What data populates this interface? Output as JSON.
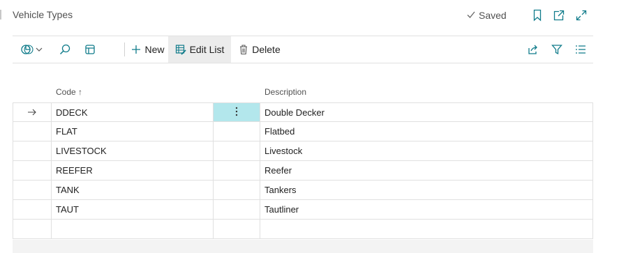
{
  "page": {
    "title": "Vehicle Types",
    "saved_label": "Saved"
  },
  "toolbar": {
    "new_label": "New",
    "edit_list_label": "Edit List",
    "delete_label": "Delete"
  },
  "colors": {
    "accent": "#0f7b8a",
    "selected_cell": "#b3e7ec",
    "active_button": "#ececec"
  },
  "table": {
    "columns": {
      "code": "Code",
      "sort_indicator": "↑",
      "description": "Description"
    },
    "rows": [
      {
        "code": "DDECK",
        "description": "Double Decker",
        "current": true
      },
      {
        "code": "FLAT",
        "description": "Flatbed"
      },
      {
        "code": "LIVESTOCK",
        "description": "Livestock"
      },
      {
        "code": "REEFER",
        "description": "Reefer"
      },
      {
        "code": "TANK",
        "description": "Tankers"
      },
      {
        "code": "TAUT",
        "description": "Tautliner"
      },
      {
        "code": "",
        "description": ""
      }
    ]
  },
  "icons": {
    "header": [
      "check-icon",
      "bookmark-icon",
      "open-new-window-icon",
      "expand-icon"
    ],
    "toolbar": [
      "analysis-icon",
      "chevron-down-icon",
      "search-icon",
      "layout-icon",
      "plus-icon",
      "edit-list-icon",
      "trash-icon",
      "share-icon",
      "filter-icon",
      "list-view-icon"
    ],
    "row": [
      "arrow-right-icon",
      "more-vertical-icon"
    ]
  }
}
